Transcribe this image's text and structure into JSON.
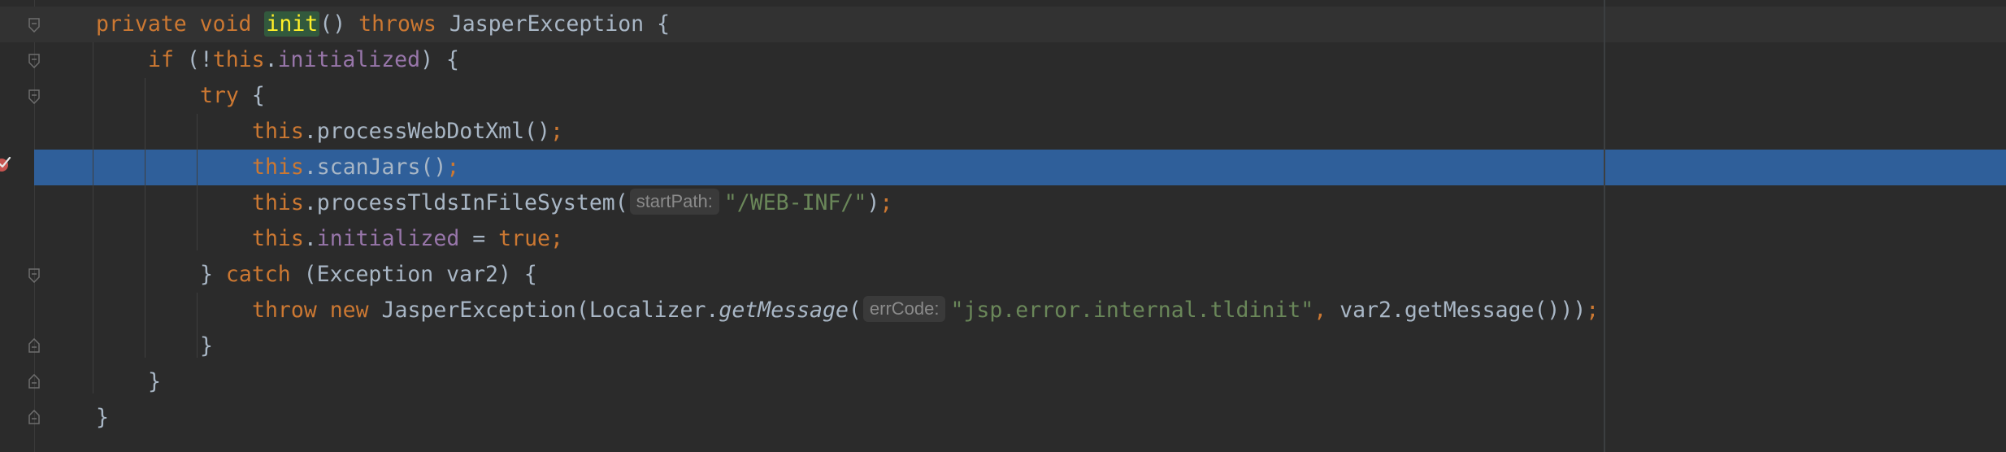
{
  "editor": {
    "lines": [
      [
        {
          "t": "private void ",
          "c": "kw"
        },
        {
          "t": "init",
          "c": "match"
        },
        {
          "t": "() ",
          "c": ""
        },
        {
          "t": "throws ",
          "c": "kw"
        },
        {
          "t": "JasperException {",
          "c": ""
        }
      ],
      [
        {
          "t": "if ",
          "c": "kw"
        },
        {
          "t": "(!",
          "c": ""
        },
        {
          "t": "this",
          "c": "kw"
        },
        {
          "t": ".",
          "c": ""
        },
        {
          "t": "initialized",
          "c": "fld"
        },
        {
          "t": ") {",
          "c": ""
        }
      ],
      [
        {
          "t": "try ",
          "c": "kw"
        },
        {
          "t": "{",
          "c": ""
        }
      ],
      [
        {
          "t": "this",
          "c": "kw"
        },
        {
          "t": ".processWebDotXml()",
          "c": ""
        },
        {
          "t": ";",
          "c": "kw"
        }
      ],
      [
        {
          "t": "this",
          "c": "kw"
        },
        {
          "t": ".scanJars()",
          "c": ""
        },
        {
          "t": ";",
          "c": "kw"
        }
      ],
      [
        {
          "t": "this",
          "c": "kw"
        },
        {
          "t": ".processTldsInFileSystem(",
          "c": ""
        },
        {
          "t": "startPath:",
          "c": "hint"
        },
        {
          "t": "\"/WEB-INF/\"",
          "c": "str"
        },
        {
          "t": ")",
          "c": ""
        },
        {
          "t": ";",
          "c": "kw"
        }
      ],
      [
        {
          "t": "this",
          "c": "kw"
        },
        {
          "t": ".",
          "c": ""
        },
        {
          "t": "initialized",
          "c": "fld"
        },
        {
          "t": " = ",
          "c": ""
        },
        {
          "t": "true",
          "c": "kw"
        },
        {
          "t": ";",
          "c": "kw"
        }
      ],
      [
        {
          "t": "} ",
          "c": ""
        },
        {
          "t": "catch ",
          "c": "kw"
        },
        {
          "t": "(Exception var2) {",
          "c": ""
        }
      ],
      [
        {
          "t": "throw new ",
          "c": "kw"
        },
        {
          "t": "JasperException(Localizer.",
          "c": ""
        },
        {
          "t": "getMessage",
          "c": "ital"
        },
        {
          "t": "(",
          "c": ""
        },
        {
          "t": "errCode:",
          "c": "hint"
        },
        {
          "t": "\"jsp.error.internal.tldinit\"",
          "c": "str"
        },
        {
          "t": ", ",
          "c": "kw"
        },
        {
          "t": "var2.getMessage()))",
          "c": ""
        },
        {
          "t": ";",
          "c": "kw"
        }
      ],
      [
        {
          "t": "}",
          "c": ""
        }
      ],
      [
        {
          "t": "}",
          "c": ""
        }
      ],
      [
        {
          "t": "}",
          "c": ""
        }
      ]
    ]
  }
}
